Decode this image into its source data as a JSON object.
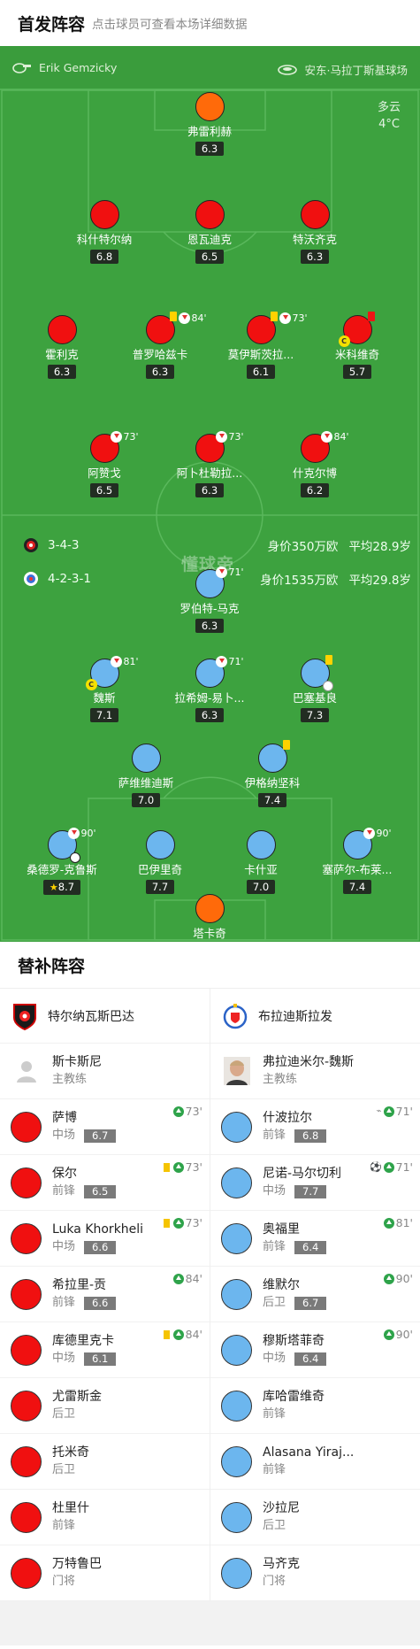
{
  "header": {
    "title": "首发阵容",
    "subtitle": "点击球员可查看本场详细数据"
  },
  "pitch": {
    "referee": "Erik Gemzicky",
    "venue": "安东·马拉丁斯基球场",
    "weather": {
      "condition": "多云",
      "temp": "4°C"
    },
    "watermark": "懂球帝",
    "home": {
      "formation": "3-4-3",
      "value_label": "身价350万欧",
      "age_label": "平均28.9岁"
    },
    "away": {
      "formation": "4-2-3-1",
      "value_label": "身价1535万欧",
      "age_label": "平均29.8岁"
    },
    "players": [
      {
        "name": "弗雷利赫",
        "rating": "6.3",
        "team": "orange"
      },
      {
        "name": "科什特尔纳",
        "rating": "6.8",
        "team": "red"
      },
      {
        "name": "恩瓦迪克",
        "rating": "6.5",
        "team": "red"
      },
      {
        "name": "特沃齐克",
        "rating": "6.3",
        "team": "red"
      },
      {
        "name": "霍利克",
        "rating": "6.3",
        "team": "red"
      },
      {
        "name": "普罗哈兹卡",
        "rating": "6.3",
        "team": "red",
        "sub": "84'",
        "yellow": true
      },
      {
        "name": "莫伊斯茨拉...",
        "rating": "6.1",
        "team": "red",
        "sub": "73'",
        "yellow": true
      },
      {
        "name": "米科维奇",
        "rating": "5.7",
        "team": "red",
        "red_card": true,
        "captain": "C"
      },
      {
        "name": "阿赞戈",
        "rating": "6.5",
        "team": "red",
        "sub": "73'"
      },
      {
        "name": "阿卜杜勒拉...",
        "rating": "6.3",
        "team": "red",
        "sub": "73'"
      },
      {
        "name": "什克尔博",
        "rating": "6.2",
        "team": "red",
        "sub": "84'"
      },
      {
        "name": "罗伯特-马克",
        "rating": "6.3",
        "team": "blue",
        "sub": "71'"
      },
      {
        "name": "魏斯",
        "rating": "7.1",
        "team": "blue",
        "sub": "81'",
        "captain": "C"
      },
      {
        "name": "拉希姆-易卜...",
        "rating": "6.3",
        "team": "blue",
        "sub": "71'"
      },
      {
        "name": "巴塞基良",
        "rating": "7.3",
        "team": "blue",
        "yellow": true,
        "ball": true
      },
      {
        "name": "萨维维迪斯",
        "rating": "7.0",
        "team": "blue"
      },
      {
        "name": "伊格纳坚科",
        "rating": "7.4",
        "team": "blue",
        "yellow": true
      },
      {
        "name": "桑德罗-克鲁斯",
        "rating": "8.7",
        "team": "blue",
        "sub": "90'",
        "goal": true,
        "star": true
      },
      {
        "name": "巴伊里奇",
        "rating": "7.7",
        "team": "blue"
      },
      {
        "name": "卡什亚",
        "rating": "7.0",
        "team": "blue"
      },
      {
        "name": "塞萨尔-布莱...",
        "rating": "7.4",
        "team": "blue",
        "sub": "90'"
      },
      {
        "name": "塔卡奇",
        "rating": "6.9",
        "team": "orange"
      }
    ]
  },
  "bench": {
    "title": "替补阵容",
    "home": {
      "team_name": "特尔纳瓦斯巴达",
      "coach": {
        "name": "斯卡斯尼",
        "role": "主教练"
      },
      "players": [
        {
          "name": "萨博",
          "pos": "中场",
          "rating": "6.7",
          "event": "73'"
        },
        {
          "name": "保尔",
          "pos": "前锋",
          "rating": "6.5",
          "event": "73'",
          "yellow": true
        },
        {
          "name": "Luka Khorkheli",
          "pos": "中场",
          "rating": "6.6",
          "event": "73'",
          "yellow": true
        },
        {
          "name": "希拉里-贡",
          "pos": "前锋",
          "rating": "6.6",
          "event": "84'"
        },
        {
          "name": "库德里克卡",
          "pos": "中场",
          "rating": "6.1",
          "event": "84'",
          "yellow": true
        },
        {
          "name": "尤雷斯金",
          "pos": "后卫"
        },
        {
          "name": "托米奇",
          "pos": "后卫"
        },
        {
          "name": "杜里什",
          "pos": "前锋"
        },
        {
          "name": "万特鲁巴",
          "pos": "门将"
        }
      ]
    },
    "away": {
      "team_name": "布拉迪斯拉发",
      "coach": {
        "name": "弗拉迪米尔-魏斯",
        "role": "主教练"
      },
      "players": [
        {
          "name": "什波拉尔",
          "pos": "前锋",
          "rating": "6.8",
          "event": "71'",
          "boot": true
        },
        {
          "name": "尼诺-马尔切利",
          "pos": "中场",
          "rating": "7.7",
          "event": "71'",
          "goal": true
        },
        {
          "name": "奥福里",
          "pos": "前锋",
          "rating": "6.4",
          "event": "81'"
        },
        {
          "name": "维默尔",
          "pos": "后卫",
          "rating": "6.7",
          "event": "90'"
        },
        {
          "name": "穆斯塔菲奇",
          "pos": "中场",
          "rating": "6.4",
          "event": "90'"
        },
        {
          "name": "库哈雷维奇",
          "pos": "前锋"
        },
        {
          "name": "Alasana Yiraj...",
          "pos": "前锋"
        },
        {
          "name": "沙拉尼",
          "pos": "后卫"
        },
        {
          "name": "马齐克",
          "pos": "门将"
        }
      ]
    }
  }
}
